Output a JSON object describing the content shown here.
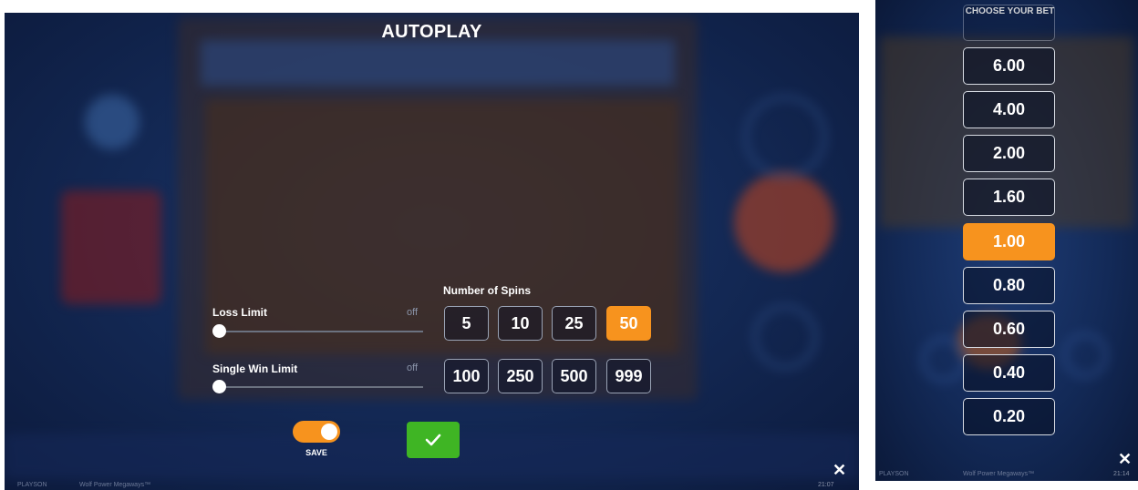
{
  "autoplay": {
    "title": "AUTOPLAY",
    "loss_limit": {
      "label": "Loss Limit",
      "value": "off"
    },
    "single_win_limit": {
      "label": "Single Win Limit",
      "value": "off"
    },
    "spins": {
      "label": "Number of Spins",
      "options": [
        "5",
        "10",
        "25",
        "50",
        "100",
        "250",
        "500",
        "999"
      ],
      "selected": "50"
    },
    "save": {
      "label": "SAVE",
      "enabled": true
    },
    "confirm_icon": "check-icon",
    "close_icon": "close-icon",
    "footer": {
      "brand": "PLAYSON",
      "game": "Wolf Power Megaways™",
      "time": "21:07"
    }
  },
  "bet_panel": {
    "title": "CHOOSE YOUR BET",
    "options": [
      "6.00",
      "4.00",
      "2.00",
      "1.60",
      "1.00",
      "0.80",
      "0.60",
      "0.40",
      "0.20"
    ],
    "selected": "1.00",
    "close_icon": "close-icon",
    "footer": {
      "brand": "PLAYSON",
      "game": "Wolf Power Megaways™",
      "time": "21:14"
    }
  },
  "colors": {
    "accent": "#f7931e",
    "confirm": "#3fb524",
    "background": "#142a57"
  }
}
